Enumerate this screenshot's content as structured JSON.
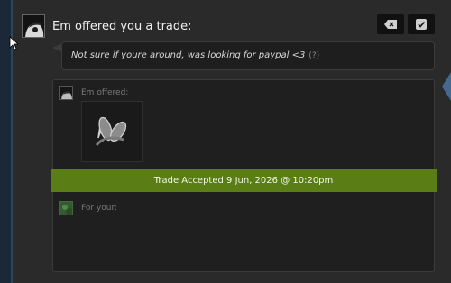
{
  "colors": {
    "accent_green": "#5b7d16",
    "panel_bg": "#2a2a2a",
    "box_bg": "#1f1f1f",
    "side_blue": "#1b2838"
  },
  "header": {
    "title": "Em offered you a trade:",
    "buttons": [
      {
        "icon": "decline-tag-icon"
      },
      {
        "icon": "checkbox-icon"
      }
    ]
  },
  "message": {
    "text": "Not sure if youre around, was looking for paypal <3",
    "help": "(?)"
  },
  "trade": {
    "offered_label": "Em offered:",
    "item_icon": "rabbit-ears-headband-icon",
    "status": "Trade Accepted 9 Jun, 2026 @ 10:20pm",
    "for_label": "For your:"
  }
}
